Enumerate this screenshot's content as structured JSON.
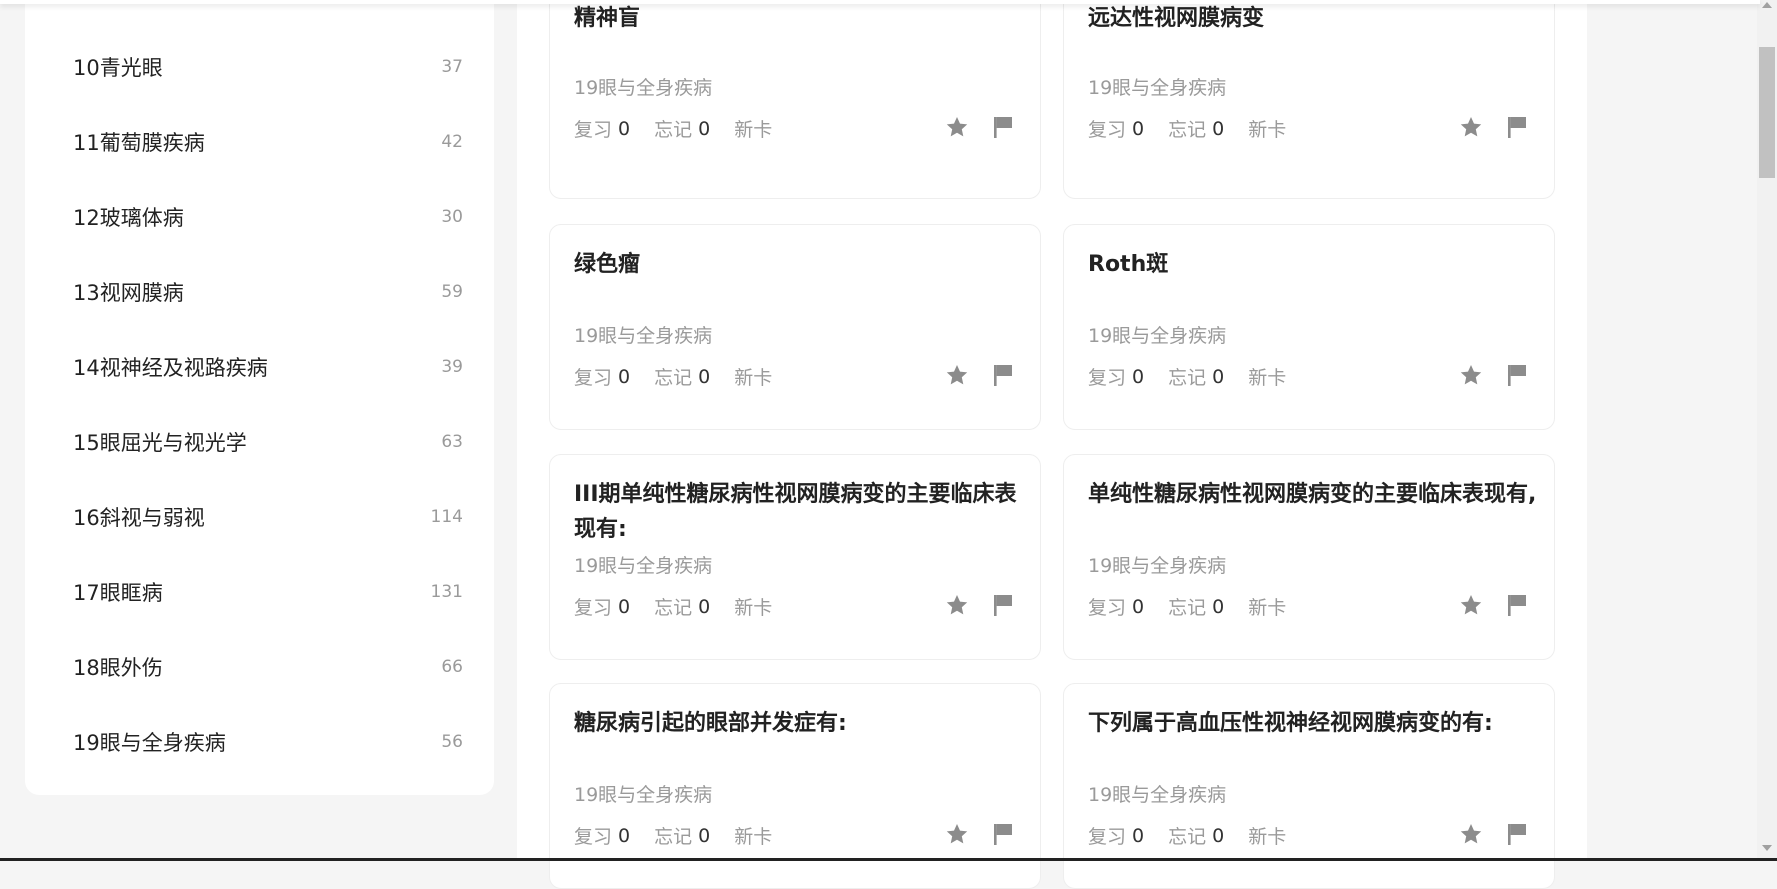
{
  "categories": [
    {
      "label": "10青光眼",
      "count": "37"
    },
    {
      "label": "11葡萄膜疾病",
      "count": "42"
    },
    {
      "label": "12玻璃体病",
      "count": "30"
    },
    {
      "label": "13视网膜病",
      "count": "59"
    },
    {
      "label": "14视神经及视路疾病",
      "count": "39"
    },
    {
      "label": "15眼屈光与视光学",
      "count": "63"
    },
    {
      "label": "16斜视与弱视",
      "count": "114"
    },
    {
      "label": "17眼眶病",
      "count": "131"
    },
    {
      "label": "18眼外伤",
      "count": "66"
    },
    {
      "label": "19眼与全身疾病",
      "count": "56"
    }
  ],
  "card_labels": {
    "review": "复习",
    "forget": "忘记",
    "new": "新卡"
  },
  "cards": [
    {
      "title": "精神盲",
      "category": "19眼与全身疾病",
      "review": "0",
      "forget": "0"
    },
    {
      "title": "远达性视网膜病变",
      "category": "19眼与全身疾病",
      "review": "0",
      "forget": "0"
    },
    {
      "title": "绿色瘤",
      "category": "19眼与全身疾病",
      "review": "0",
      "forget": "0"
    },
    {
      "title": "Roth斑",
      "category": "19眼与全身疾病",
      "review": "0",
      "forget": "0"
    },
    {
      "title": "III期单纯性糖尿病性视网膜病变的主要临床表现有:",
      "category": "19眼与全身疾病",
      "review": "0",
      "forget": "0"
    },
    {
      "title": "单纯性糖尿病性视网膜病变的主要临床表现有,",
      "category": "19眼与全身疾病",
      "review": "0",
      "forget": "0"
    },
    {
      "title": "糖尿病引起的眼部并发症有:",
      "category": "19眼与全身疾病",
      "review": "0",
      "forget": "0"
    },
    {
      "title": "下列属于高血压性视神经视网膜病变的有:",
      "category": "19眼与全身疾病",
      "review": "0",
      "forget": "0"
    }
  ],
  "icons": {
    "favorite": "star-icon",
    "mark": "flag-icon"
  },
  "colors": {
    "icon": "#8c8c8c",
    "muted_text": "#9a9a9a"
  }
}
